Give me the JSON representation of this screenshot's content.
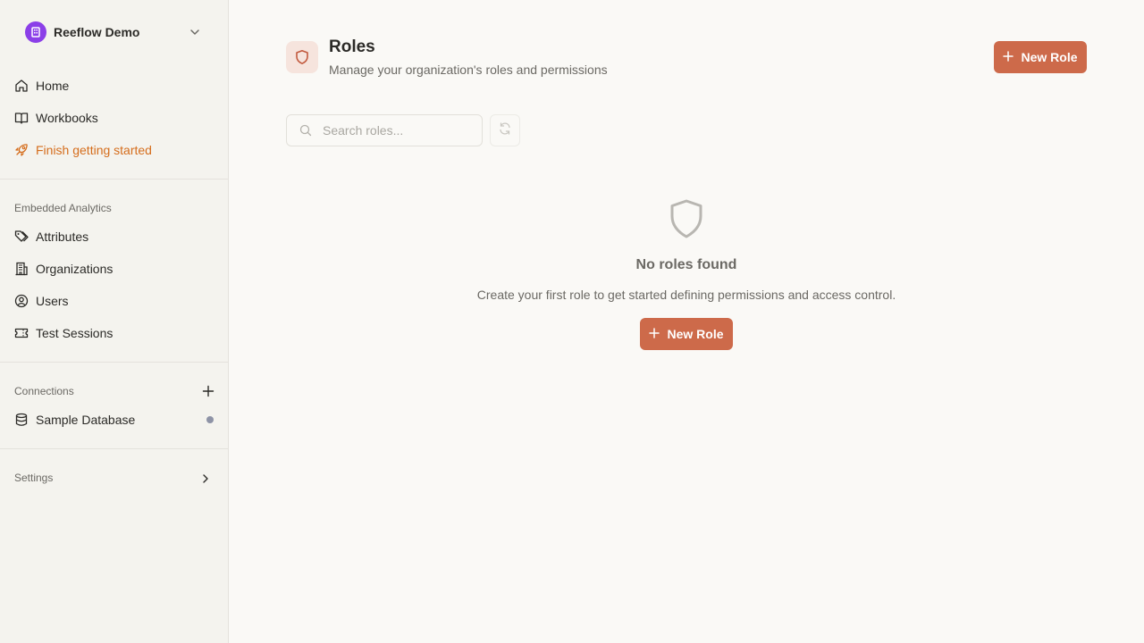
{
  "sidebar": {
    "org_name": "Reeflow Demo",
    "nav": [
      {
        "label": "Home",
        "icon": "home-icon"
      },
      {
        "label": "Workbooks",
        "icon": "book-icon"
      },
      {
        "label": "Finish getting started",
        "icon": "rocket-icon",
        "accent": "#d56d1c"
      }
    ],
    "embedded_section": "Embedded Analytics",
    "embedded": [
      {
        "label": "Attributes",
        "icon": "tags-icon"
      },
      {
        "label": "Organizations",
        "icon": "building-icon"
      },
      {
        "label": "Users",
        "icon": "user-circle-icon"
      },
      {
        "label": "Test Sessions",
        "icon": "ticket-icon"
      }
    ],
    "connections_section": "Connections",
    "connections": [
      {
        "label": "Sample Database",
        "icon": "database-icon",
        "status_color": "#8e93a6"
      }
    ],
    "settings_label": "Settings"
  },
  "header": {
    "title": "Roles",
    "subtitle": "Manage your organization's roles and permissions",
    "new_role_label": "New Role"
  },
  "search": {
    "placeholder": "Search roles...",
    "value": ""
  },
  "empty_state": {
    "title": "No roles found",
    "description": "Create your first role to get started defining permissions and access control.",
    "button_label": "New Role"
  },
  "colors": {
    "primary": "#cd6a4a",
    "accent": "#d56d1c",
    "org_logo": "#8b3fe8"
  }
}
